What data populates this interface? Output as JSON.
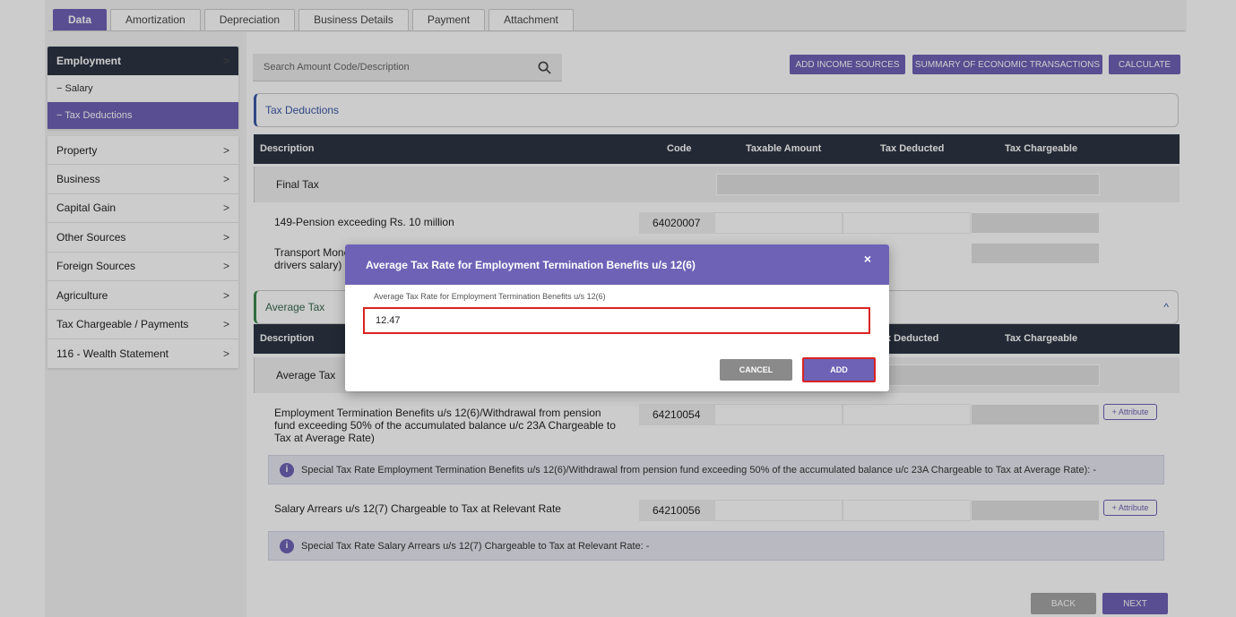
{
  "tabs": [
    {
      "label": "Data",
      "active": true
    },
    {
      "label": "Amortization"
    },
    {
      "label": "Depreciation"
    },
    {
      "label": "Business Details"
    },
    {
      "label": "Payment"
    },
    {
      "label": "Attachment"
    }
  ],
  "sidebar": {
    "employment": {
      "label": "Employment",
      "subitems": [
        {
          "label": "− Salary"
        },
        {
          "label": "− Tax Deductions",
          "active": true
        }
      ]
    },
    "items": [
      {
        "label": "Property"
      },
      {
        "label": "Business"
      },
      {
        "label": "Capital Gain"
      },
      {
        "label": "Other Sources"
      },
      {
        "label": "Foreign Sources"
      },
      {
        "label": "Agriculture"
      },
      {
        "label": "Tax Chargeable / Payments"
      },
      {
        "label": "116 - Wealth Statement"
      }
    ],
    "chevron": ">"
  },
  "search": {
    "placeholder": "Search Amount Code/Description"
  },
  "toolbar": {
    "add_income_sources": "ADD INCOME SOURCES",
    "summary": "SUMMARY OF ECONOMIC TRANSACTIONS",
    "calculate": "CALCULATE"
  },
  "tax_deductions": {
    "title": "Tax Deductions",
    "columns": [
      "Description",
      "Code",
      "Taxable Amount",
      "Tax Deducted",
      "Tax Chargeable"
    ],
    "group_label": "Final Tax",
    "rows": [
      {
        "description": "149-Pension exceeding Rs. 10 million",
        "code": "64020007"
      },
      {
        "description_line1": "Transport Mone",
        "description_line2": "drivers salary) u"
      }
    ]
  },
  "average_tax": {
    "title": "Average Tax",
    "collapse_icon": "^",
    "columns": [
      "Description",
      "x Deducted",
      "Tax Chargeable"
    ],
    "group_label": "Average Tax",
    "rows": [
      {
        "description_line1": "Employment Termination Benefits u/s 12(6)/Withdrawal from pension",
        "description_line2": "fund exceeding 50% of the accumulated balance u/c 23A Chargeable to",
        "description_line3": "Tax at Average Rate)",
        "code": "64210054",
        "attribute_label": "+ Attribute",
        "info": "Special Tax Rate Employment Termination Benefits u/s 12(6)/Withdrawal from pension fund exceeding 50% of the accumulated balance u/c 23A Chargeable to Tax at Average Rate): -"
      },
      {
        "description": "Salary Arrears u/s 12(7) Chargeable to Tax at Relevant Rate",
        "code": "64210056",
        "attribute_label": "+ Attribute",
        "info": "Special Tax Rate Salary Arrears u/s 12(7) Chargeable to Tax at Relevant Rate: -"
      }
    ]
  },
  "nav": {
    "back": "BACK",
    "next": "NEXT"
  },
  "modal": {
    "title": "Average Tax Rate for Employment Termination Benefits u/s 12(6)",
    "close": "×",
    "field_label": "Average Tax Rate for Employment Termination Benefits u/s 12(6)",
    "field_value": "12.47",
    "cancel": "CANCEL",
    "add": "ADD"
  },
  "colors": {
    "accent": "#6e62b6",
    "dark": "#2c3544",
    "highlight": "#d92323"
  }
}
